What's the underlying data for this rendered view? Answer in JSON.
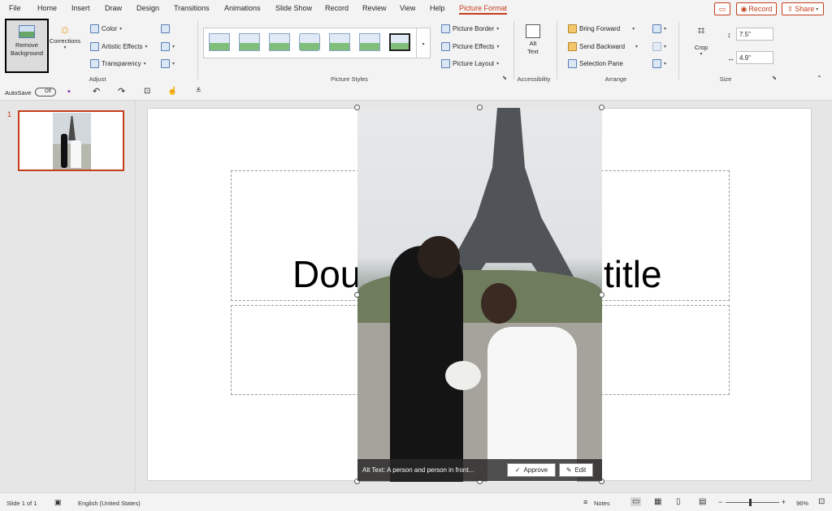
{
  "tabs": [
    "File",
    "Home",
    "Insert",
    "Draw",
    "Design",
    "Transitions",
    "Animations",
    "Slide Show",
    "Record",
    "Review",
    "View",
    "Help",
    "Picture Format"
  ],
  "topbar": {
    "comment_icon": "comment-icon",
    "record": "Record",
    "share": "Share"
  },
  "ribbon": {
    "remove_background": "Remove Background",
    "corrections": "Corrections",
    "color": "Color",
    "artistic_effects": "Artistic Effects",
    "transparency": "Transparency",
    "group_adjust": "Adjust",
    "group_picture_styles": "Picture Styles",
    "picture_border": "Picture Border",
    "picture_effects": "Picture Effects",
    "picture_layout": "Picture Layout",
    "alt_text": "Alt Text",
    "group_accessibility": "Accessibility",
    "bring_forward": "Bring Forward",
    "send_backward": "Send Backward",
    "selection_pane": "Selection Pane",
    "group_arrange": "Arrange",
    "crop": "Crop",
    "height": "7.5\"",
    "width": "4.9\"",
    "group_size": "Size"
  },
  "qat": {
    "autosave": "AutoSave",
    "toggle": "Off"
  },
  "thumbnail": {
    "number": "1"
  },
  "slide": {
    "title_left": "Dou",
    "title_right": "title"
  },
  "alttext_bar": {
    "text": "Alt Text: A person and person in front...",
    "approve": "Approve",
    "edit": "Edit"
  },
  "status": {
    "slide_count": "Slide 1 of 1",
    "language": "English (United States)",
    "notes": "Notes",
    "zoom": "96%",
    "zoom_minus": "−",
    "zoom_plus": "+"
  },
  "colors": {
    "accent": "#c43e1c",
    "ribbon_bg": "#f3f3f3",
    "bg": "#e6e6e6"
  }
}
